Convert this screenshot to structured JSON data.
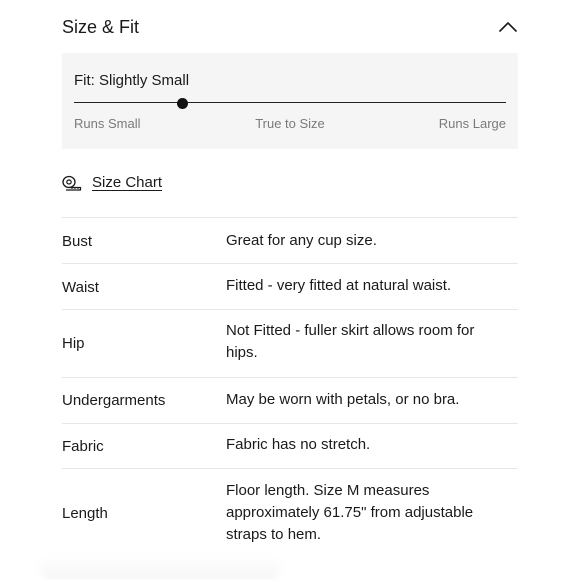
{
  "section": {
    "title": "Size & Fit",
    "collapse_icon": "chevron-up-icon"
  },
  "fit": {
    "label": "Fit: Slightly Small",
    "slider_value": 0.25,
    "scale_labels": [
      "Runs Small",
      "True to Size",
      "Runs Large"
    ]
  },
  "size_chart": {
    "icon": "measuring-tape-icon",
    "label": "Size Chart"
  },
  "details": [
    {
      "label": "Bust",
      "value": "Great for any cup size."
    },
    {
      "label": "Waist",
      "value": "Fitted - very fitted at natural waist."
    },
    {
      "label": "Hip",
      "value": "Not Fitted - fuller skirt allows room for hips."
    },
    {
      "label": "Undergarments",
      "value": "May be worn with petals, or no bra."
    },
    {
      "label": "Fabric",
      "value": "Fabric has no stretch."
    },
    {
      "label": "Length",
      "value": "Floor length. Size M measures approximately 61.75\" from adjustable straps to hem."
    }
  ]
}
